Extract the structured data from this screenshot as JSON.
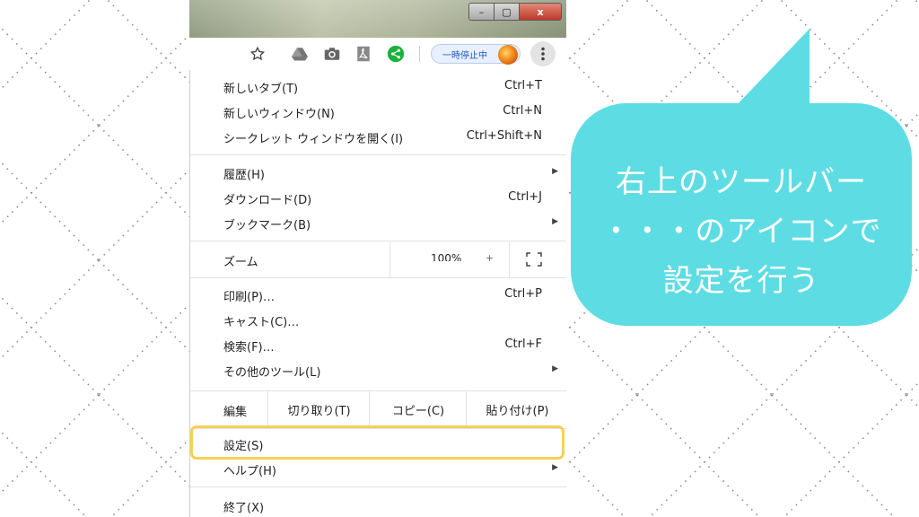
{
  "toolbar": {
    "pause_label": "一時停止中",
    "icons": [
      "star-icon",
      "drive-icon",
      "camera-icon",
      "pdf-icon",
      "share-icon"
    ],
    "pill_color": "#e8f0fe"
  },
  "window_buttons": {
    "minimize": "–",
    "maximize": "▢",
    "close": "x"
  },
  "menu": {
    "new_tab": {
      "label": "新しいタブ(T)",
      "shortcut": "Ctrl+T"
    },
    "new_window": {
      "label": "新しいウィンドウ(N)",
      "shortcut": "Ctrl+N"
    },
    "incognito": {
      "label": "シークレット ウィンドウを開く(I)",
      "shortcut": "Ctrl+Shift+N"
    },
    "history": {
      "label": "履歴(H)"
    },
    "downloads": {
      "label": "ダウンロード(D)",
      "shortcut": "Ctrl+J"
    },
    "bookmarks": {
      "label": "ブックマーク(B)"
    },
    "zoom": {
      "label": "ズーム",
      "value": "100%"
    },
    "print": {
      "label": "印刷(P)…",
      "shortcut": "Ctrl+P"
    },
    "cast": {
      "label": "キャスト(C)…"
    },
    "find": {
      "label": "検索(F)…",
      "shortcut": "Ctrl+F"
    },
    "more_tools": {
      "label": "その他のツール(L)"
    },
    "edit": {
      "label": "編集",
      "cut": "切り取り(T)",
      "copy": "コピー(C)",
      "paste": "貼り付け(P)"
    },
    "settings": {
      "label": "設定(S)"
    },
    "help": {
      "label": "ヘルプ(H)"
    },
    "exit": {
      "label": "終了(X)"
    }
  },
  "callout": {
    "line1": "右上のツールバー",
    "line2": "・・・のアイコンで",
    "line3": "設定を行う",
    "color": "#5ddde3"
  },
  "highlight_color": "#f5d155"
}
